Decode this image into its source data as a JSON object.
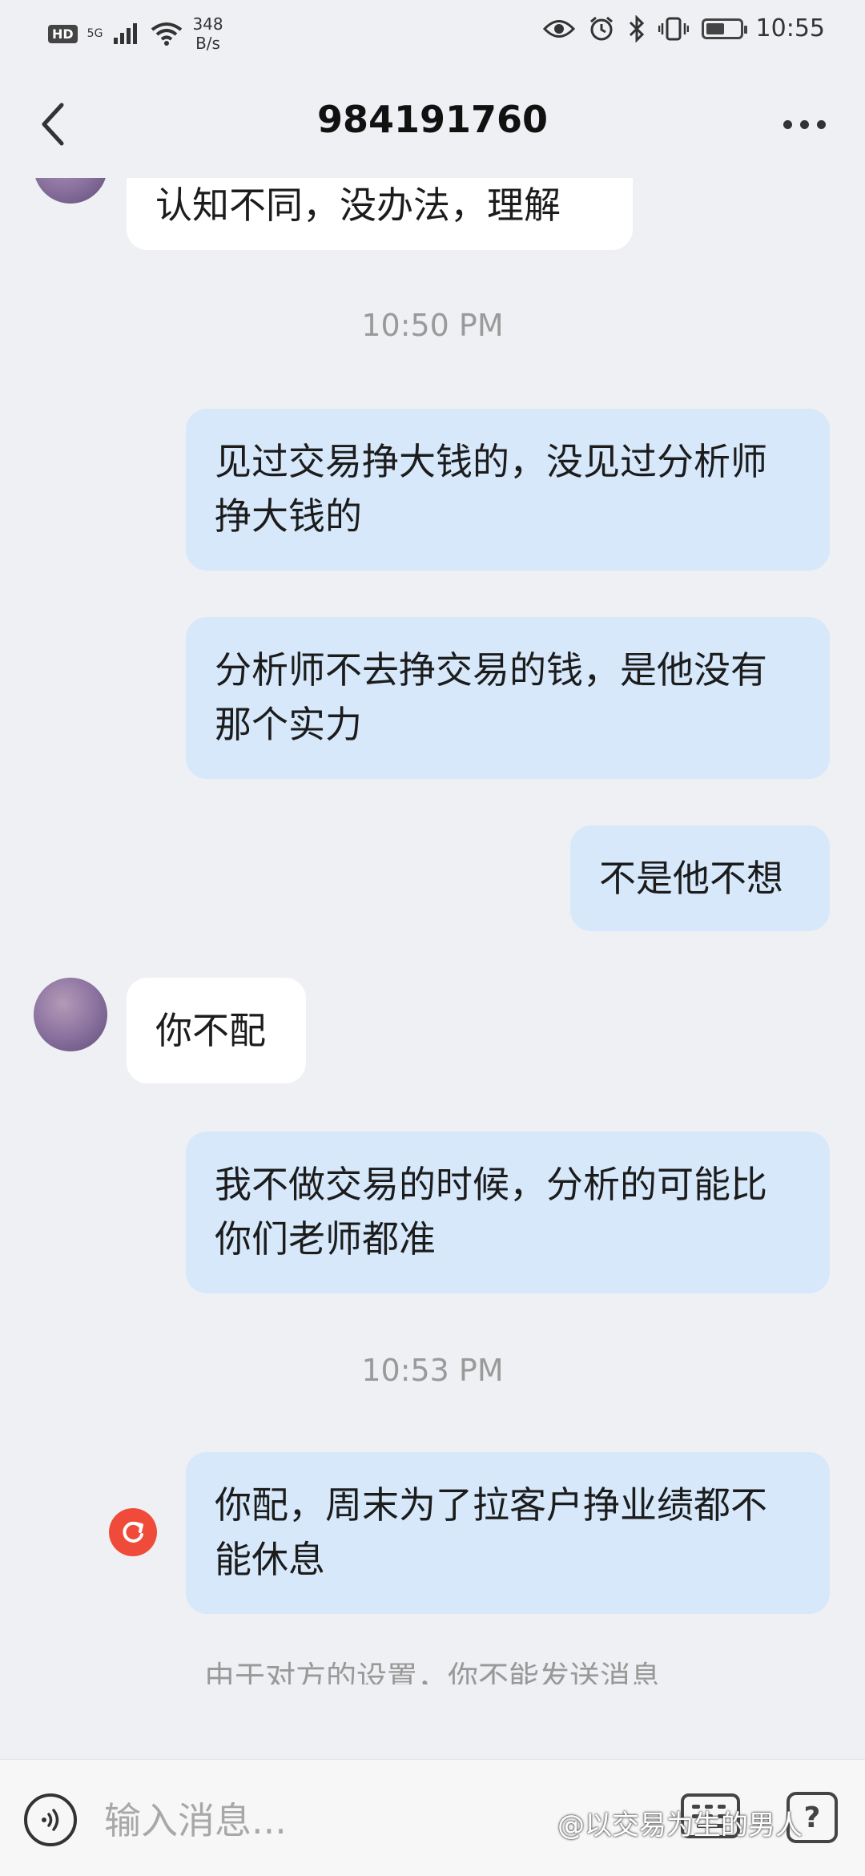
{
  "status_bar": {
    "hd": "HD",
    "net": "5G",
    "speed_value": "348",
    "speed_unit": "B/s",
    "time": "10:55",
    "battery_level": 0.55
  },
  "header": {
    "title": "984191760"
  },
  "messages": [
    {
      "text": "认知不同，没办法，理解"
    },
    {
      "text": "10:50 PM"
    },
    {
      "text": "见过交易挣大钱的，没见过分析师挣大钱的"
    },
    {
      "text": "分析师不去挣交易的钱，是他没有那个实力"
    },
    {
      "text": "不是他不想"
    },
    {
      "text": "你不配"
    },
    {
      "text": "我不做交易的时候，分析的可能比你们老师都准"
    },
    {
      "text": "10:53 PM"
    },
    {
      "text": "你配，周末为了拉客户挣业绩都不能休息"
    }
  ],
  "notice": "由于对方的设置，你不能发送消息",
  "input": {
    "placeholder": "输入消息..."
  },
  "watermark": "@以交易为生的男人"
}
